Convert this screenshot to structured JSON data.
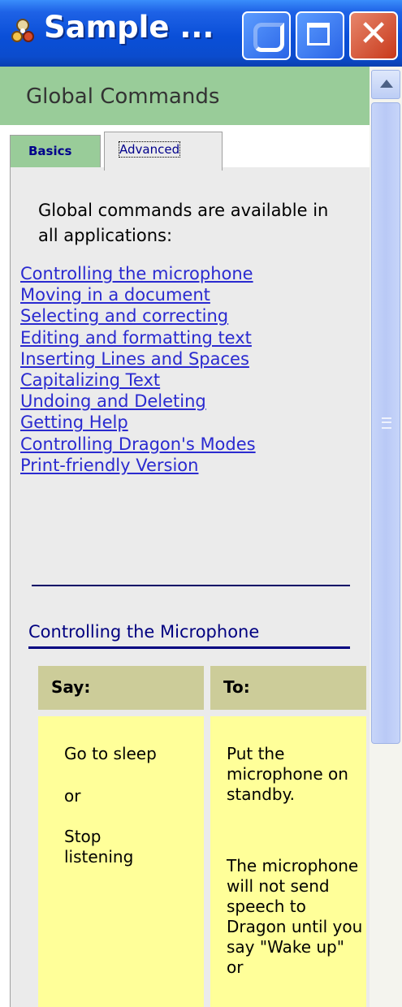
{
  "window": {
    "title": "Sample ...",
    "icon": "dragon-app-icon",
    "buttons": {
      "minimize": "minimize-icon",
      "maximize": "maximize-icon",
      "close": "close-icon",
      "close_glyph": "✕"
    }
  },
  "header": {
    "title": "Global Commands"
  },
  "tabs": [
    {
      "label": "Basics",
      "active": false
    },
    {
      "label": "Advanced",
      "active": true
    }
  ],
  "intro": "Global commands are available in all applications:",
  "links": [
    "Controlling the microphone",
    "Moving in a document",
    "Selecting and correcting",
    "Editing and formatting text",
    "Inserting Lines and Spaces",
    "Capitalizing Text",
    "Undoing and Deleting",
    "Getting Help",
    "Controlling Dragon's Modes",
    "Print-friendly Version"
  ],
  "section": {
    "title": "Controlling the Microphone",
    "table": {
      "headers": {
        "say": "Say:",
        "to": "To:"
      },
      "say": [
        "Go to sleep",
        "or",
        "Stop listening"
      ],
      "to": [
        "Put the microphone on standby.",
        "The microphone will not send speech to Dragon until you say \"Wake up\" or"
      ]
    }
  },
  "colors": {
    "header_bg": "#99cc99",
    "table_header_bg": "#cccc99",
    "table_cell_bg": "#ffff99",
    "link": "#2a2ad0",
    "section_title": "#000080"
  }
}
